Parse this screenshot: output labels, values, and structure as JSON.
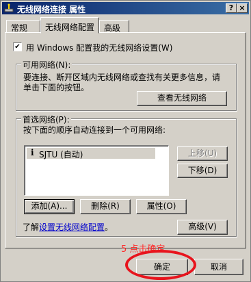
{
  "window": {
    "title": "无线网络连接 属性"
  },
  "titlebar": {
    "help": "?",
    "close": "×"
  },
  "tabs": [
    "常规",
    "无线网络配置",
    "高级"
  ],
  "checkbox": {
    "label": "用 Windows 配置我的无线网络设置(W)",
    "checked": true,
    "mark": "✔"
  },
  "available": {
    "title": "可用网络(N):",
    "desc_line1": "要连接、断开区域内无线网络或查找有关更多信息，请",
    "desc_line2": "单击下面的按钮。",
    "button": "查看无线网络"
  },
  "preferred": {
    "title": "首选网络(P):",
    "desc": "按下面的顺序自动连接到一个可用网络:",
    "items": [
      {
        "icon": "i",
        "label": "SJTU (自动)"
      }
    ],
    "move_up": "上移(U)",
    "move_down": "下移(D)",
    "add": "添加(A)...",
    "remove": "删除(R)",
    "properties": "属性(O)"
  },
  "learn": {
    "prefix": "了解",
    "link": "设置无线网络配置",
    "suffix": "。"
  },
  "advanced_button": "高级(V)",
  "ok_button": "确定",
  "cancel_button": "取消",
  "annotation": "5 点击确定"
}
